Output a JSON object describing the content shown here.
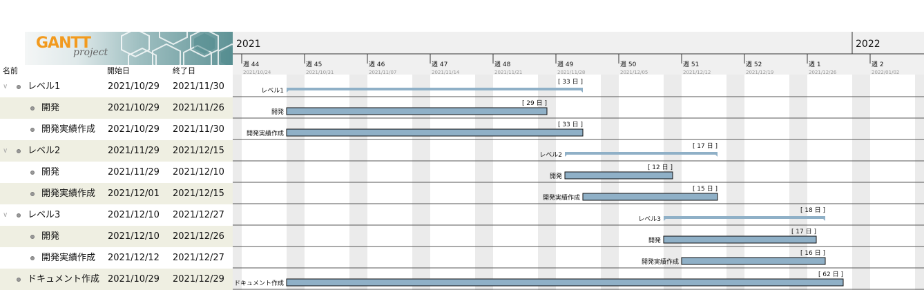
{
  "logo": {
    "brand": "GANTT",
    "sub": "project"
  },
  "table": {
    "headers": {
      "name": "名前",
      "start": "開始日",
      "end": "終了日"
    },
    "rows": [
      {
        "name": "レベル1",
        "start": "2021/10/29",
        "end": "2021/11/30",
        "level": 0,
        "collapsible": true
      },
      {
        "name": "開発",
        "start": "2021/10/29",
        "end": "2021/11/26",
        "level": 1,
        "collapsible": false
      },
      {
        "name": "開発実績作成",
        "start": "2021/10/29",
        "end": "2021/11/30",
        "level": 1,
        "collapsible": false
      },
      {
        "name": "レベル2",
        "start": "2021/11/29",
        "end": "2021/12/15",
        "level": 0,
        "collapsible": true
      },
      {
        "name": "開発",
        "start": "2021/11/29",
        "end": "2021/12/10",
        "level": 1,
        "collapsible": false
      },
      {
        "name": "開発実績作成",
        "start": "2021/12/01",
        "end": "2021/12/15",
        "level": 1,
        "collapsible": false
      },
      {
        "name": "レベル3",
        "start": "2021/12/10",
        "end": "2021/12/27",
        "level": 0,
        "collapsible": true
      },
      {
        "name": "開発",
        "start": "2021/12/10",
        "end": "2021/12/26",
        "level": 1,
        "collapsible": false
      },
      {
        "name": "開発実績作成",
        "start": "2021/12/12",
        "end": "2021/12/27",
        "level": 1,
        "collapsible": false
      },
      {
        "name": "ドキュメント作成",
        "start": "2021/10/29",
        "end": "2021/12/29",
        "level": 0,
        "collapsible": false
      }
    ]
  },
  "timeline": {
    "years": [
      {
        "label": "2021",
        "date": "2021/10/24"
      },
      {
        "label": "2022",
        "date": "2022/01/01"
      }
    ],
    "weeks": [
      {
        "label": "週 44",
        "date": "2021/10/24"
      },
      {
        "label": "週 45",
        "date": "2021/10/31"
      },
      {
        "label": "週 46",
        "date": "2021/11/07"
      },
      {
        "label": "週 47",
        "date": "2021/11/14"
      },
      {
        "label": "週 48",
        "date": "2021/11/21"
      },
      {
        "label": "週 49",
        "date": "2021/11/28"
      },
      {
        "label": "週 50",
        "date": "2021/12/05"
      },
      {
        "label": "週 51",
        "date": "2021/12/12"
      },
      {
        "label": "週 52",
        "date": "2021/12/19"
      },
      {
        "label": "週 1",
        "date": "2021/12/26"
      },
      {
        "label": "週 2",
        "date": "2022/01/02"
      }
    ]
  },
  "bars": [
    {
      "label": "レベル1",
      "duration": "[ 33 日 ]",
      "summary": true,
      "start": "2021/10/29",
      "end": "2021/11/30"
    },
    {
      "label": "開発",
      "duration": "[ 29 日 ]",
      "summary": false,
      "start": "2021/10/29",
      "end": "2021/11/26"
    },
    {
      "label": "開発実績作成",
      "duration": "[ 33 日 ]",
      "summary": false,
      "start": "2021/10/29",
      "end": "2021/11/30"
    },
    {
      "label": "レベル2",
      "duration": "[ 17 日 ]",
      "summary": true,
      "start": "2021/11/29",
      "end": "2021/12/15"
    },
    {
      "label": "開発",
      "duration": "[ 12 日 ]",
      "summary": false,
      "start": "2021/11/29",
      "end": "2021/12/10"
    },
    {
      "label": "開発実績作成",
      "duration": "[ 15 日 ]",
      "summary": false,
      "start": "2021/12/01",
      "end": "2021/12/15"
    },
    {
      "label": "レベル3",
      "duration": "[ 18 日 ]",
      "summary": true,
      "start": "2021/12/10",
      "end": "2021/12/27"
    },
    {
      "label": "開発",
      "duration": "[ 17 日 ]",
      "summary": false,
      "start": "2021/12/10",
      "end": "2021/12/26"
    },
    {
      "label": "開発実績作成",
      "duration": "[ 16 日 ]",
      "summary": false,
      "start": "2021/12/12",
      "end": "2021/12/27"
    },
    {
      "label": "ドキュメント作成",
      "duration": "[ 62 日 ]",
      "summary": false,
      "start": "2021/10/29",
      "end": "2021/12/29"
    }
  ],
  "colors": {
    "task_fill": "#8fb0c7",
    "summary_fill": "#8fb0c7",
    "weekend": "#ebebeb",
    "row_shade": "#efefe2",
    "header_bg": "#f0f0f0",
    "logo_orange": "#f29a1e"
  }
}
